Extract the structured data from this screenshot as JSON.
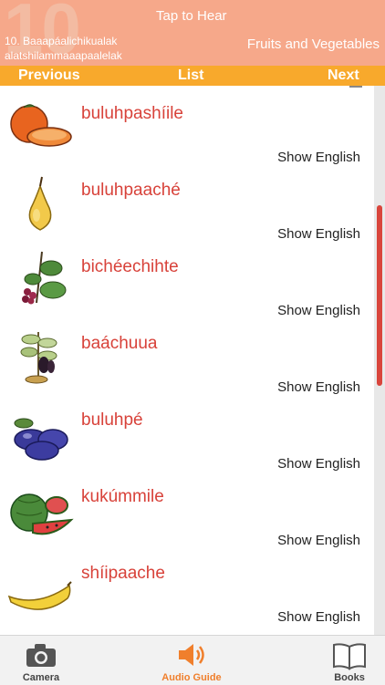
{
  "header": {
    "number": "10",
    "tap_label": "Tap to Hear",
    "subtitle_line1": "10. Baaapáalichikualak",
    "subtitle_line2": "alatshilammaaapaalelak",
    "category": "Fruits and Vegetables"
  },
  "nav": {
    "previous": "Previous",
    "list": "List",
    "next": "Next"
  },
  "items": [
    {
      "word": "buluhpashíile",
      "show": "Show English",
      "icon": "orange-icon"
    },
    {
      "word": "buluhpaaché",
      "show": "Show English",
      "icon": "pear-icon"
    },
    {
      "word": "bichéechihte",
      "show": "Show English",
      "icon": "berry-branch-icon"
    },
    {
      "word": "baáchuua",
      "show": "Show English",
      "icon": "plant-pot-icon"
    },
    {
      "word": "buluhpé",
      "show": "Show English",
      "icon": "plums-icon"
    },
    {
      "word": "kukúmmile",
      "show": "Show English",
      "icon": "watermelon-icon"
    },
    {
      "word": "shíipaache",
      "show": "Show English",
      "icon": "banana-icon"
    }
  ],
  "scroll": {
    "position_fraction": 0.22,
    "visible_fraction": 0.33
  },
  "tabs": {
    "camera": "Camera",
    "audio": "Audio Guide",
    "books": "Books"
  },
  "colors": {
    "header_bg": "#f6a88a",
    "nav_bg": "#f8a92c",
    "word_red": "#d8423a",
    "scroll_red": "#d9453c",
    "audio_orange": "#f07f2c"
  }
}
